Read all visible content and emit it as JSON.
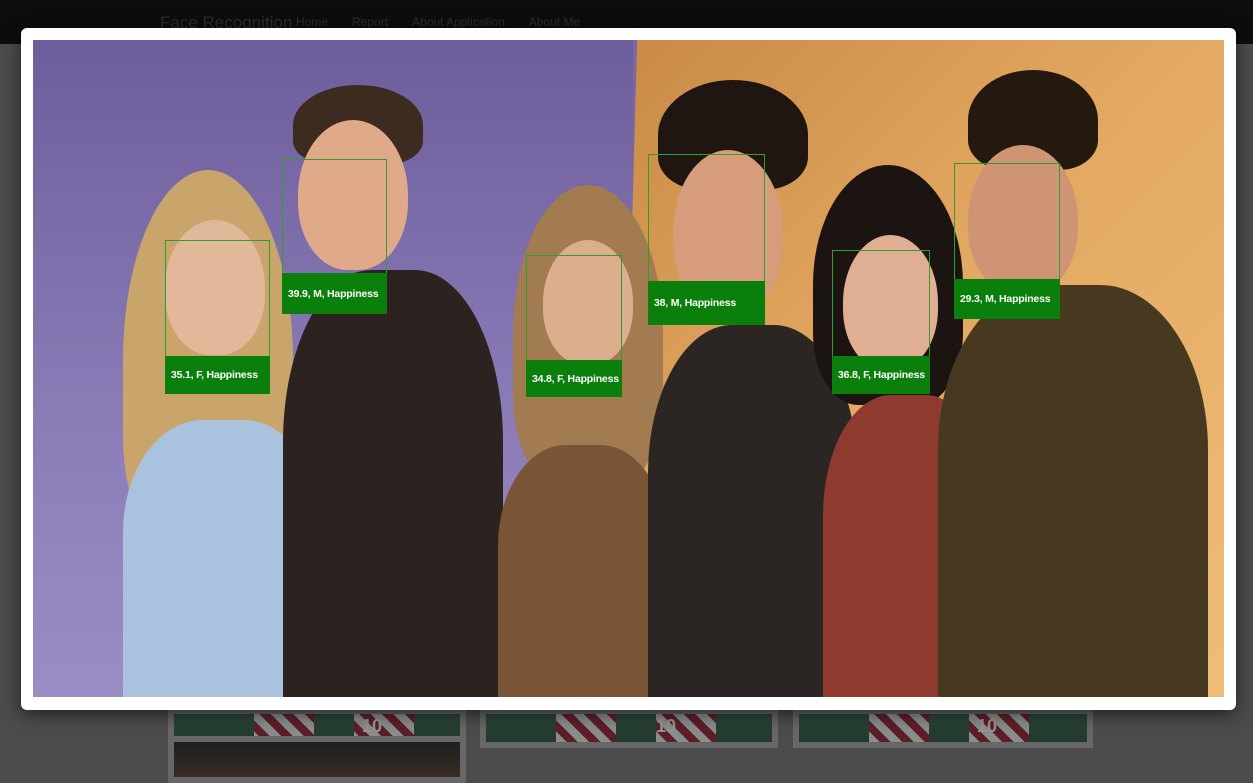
{
  "navbar": {
    "brand": "Face Recognition",
    "links": [
      "Home",
      "Report",
      "About Application",
      "About Me"
    ]
  },
  "background": {
    "thumbnail_numbers": [
      "10",
      "10",
      "10"
    ]
  },
  "modal": {
    "detections": [
      {
        "label": "35.1, F, Happiness"
      },
      {
        "label": "39.9, M, Happiness"
      },
      {
        "label": "34.8, F, Happiness"
      },
      {
        "label": "38, M, Happiness"
      },
      {
        "label": "36.8, F, Happiness"
      },
      {
        "label": "29.3, M, Happiness"
      }
    ]
  },
  "colors": {
    "label_bg": "#0b7f0b",
    "box_border": "#2f9e2f",
    "modal_bg": "#ffffff",
    "navbar_bg": "#121212"
  }
}
